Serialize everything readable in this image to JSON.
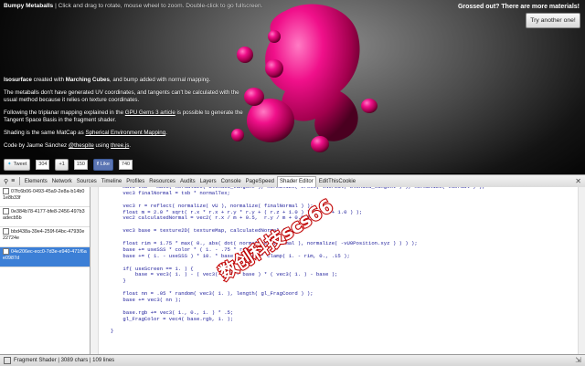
{
  "header": {
    "app_title": "Bumpy Metaballs",
    "subtitle": " | Click and drag to rotate, mouse wheel to zoom. Double-click to go fullscreen.",
    "gross_bold": "Grossed out?",
    "gross_rest": " There are more materials!",
    "try_button": "Try another one!"
  },
  "info": {
    "p1_a": "Isosurface",
    "p1_b": " created with ",
    "p1_c": "Marching Cubes",
    "p1_d": ", and bump added with normal mapping.",
    "p2": "The metaballs don't have generated UV coordinates, and tangents can't be calculated with the usual method because it relies on texture coordinates.",
    "p3_a": "Following the triplanar mapping explained in the ",
    "p3_b": "GPU Gems 3 article",
    "p3_c": " is possible to generate the Tangent Space Basis in the fragment shader.",
    "p4_a": "Shading is the same MatCap as ",
    "p4_b": "Spherical Environment Mapping",
    "p4_c": ".",
    "p5_a": "Code by Jaume Sánchez ",
    "p5_b": "@thespite",
    "p5_c": " using ",
    "p5_d": "three.js",
    "p5_e": "."
  },
  "social": {
    "tweet": "Tweet",
    "tweet_count": "304",
    "gplus": "+1",
    "gplus_count": "150",
    "like": "Like",
    "like_count": "740"
  },
  "devtools": {
    "tabs": [
      "Elements",
      "Network",
      "Sources",
      "Timeline",
      "Profiles",
      "Resources",
      "Audits",
      "Layers",
      "Console",
      "PageSpeed",
      "Shader Editor",
      "EditThisCookie"
    ],
    "active_tab": "Shader Editor",
    "programs": [
      "07fc6b06-0493-45a9-2e8a-b14b01e8b33f",
      "0e384b78-4177-bfe8-2456-497b3adecb5b",
      "bbd438a-39e4-259f-64bc-47930e22724e",
      "04e206ec-ecc0-7d3e-e940-471f6ae0987d"
    ],
    "selected_index": 3,
    "code_lines": [
      "    mat3 tsb = mat3( normalize( blended_tangent ), normalize( cross( vNormal, blended_tangent ) ), normalize( vNormal ) );",
      "    vec3 finalNormal = tsb * normalTex;",
      "",
      "    vec3 r = reflect( normalize( vU ), normalize( finalNormal ) );",
      "    float m = 2.0 * sqrt( r.x * r.x + r.y * r.y + ( r.z + 1.0 ) * ( r.z + 1.0 ) );",
      "    vec2 calculatedNormal = vec2( r.x / m + 0.5,  r.y / m + 0.5 );",
      "",
      "    vec3 base = texture2D( textureMap, calculatedNormal ).rgb;",
      "",
      "    float rim = 1.75 * max( 0., abs( dot( normalize( vNormal ), normalize( -vU0Position.xyz ) ) ) );",
      "    base += useSSS * color * ( 1. - .75 * rim );",
      "    base += ( 1. - useSSS ) * 10. * base * color * clamp( 1. - rim, 0., .15 );",
      "",
      "    if( useScreen == 1. ) {",
      "        base = vec3( 1. ) - ( vec3( 1. ) - base ) * ( vec3( 1. ) - base );",
      "    }",
      "",
      "    float nn = .05 * random( vec3( 1. ), length( gl_FragCoord ) );",
      "    base += vec3( nn );",
      "",
      "    base.rgb += vec3( 1., 0., 1. ) * .5;",
      "    gl_FragColor = vec4( base.rgb, 1. );",
      "",
      "}"
    ],
    "status_text": "Fragment Shader  |  3089 chars  |  109 lines"
  },
  "watermark": "数创科技scs66",
  "colors": {
    "blob": "#e8007a",
    "selected": "#3c7fd6",
    "code": "#1a1a99"
  }
}
